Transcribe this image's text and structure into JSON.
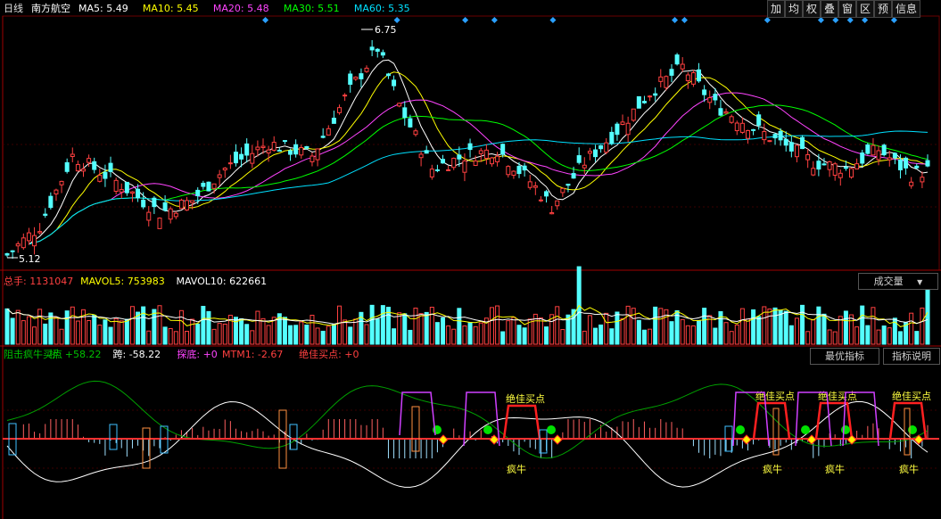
{
  "header": {
    "period": "日线",
    "stock": "南方航空",
    "ma_items": [
      {
        "label": "MA5: 5.49",
        "color": "#ffffff"
      },
      {
        "label": "MA10: 5.45",
        "color": "#ffff00"
      },
      {
        "label": "MA20: 5.48",
        "color": "#ff44ff"
      },
      {
        "label": "MA30: 5.51",
        "color": "#00ff00"
      },
      {
        "label": "MA60: 5.35",
        "color": "#00e0ff"
      }
    ]
  },
  "toolbar": [
    "加",
    "均",
    "权",
    "叠",
    "窗",
    "区",
    "预",
    "信息"
  ],
  "price_chart": {
    "type": "candlestick",
    "high_label": "6.75",
    "low_label": "5.12",
    "ymin": 5.0,
    "ymax": 7.0,
    "num_bars": 170,
    "markers": [
      53,
      80,
      94,
      100,
      112,
      137,
      139,
      156,
      167,
      170,
      173,
      176,
      182
    ],
    "ma_colors": {
      "ma5": "#ffffff",
      "ma10": "#ffff00",
      "ma20": "#ff44ff",
      "ma30": "#00ff00",
      "ma60": "#00e0ff"
    }
  },
  "volume_panel": {
    "items": [
      {
        "label": "总手: 1131047",
        "color": "#ff4040"
      },
      {
        "label": "MAVOL5: 753983",
        "color": "#ffff00"
      },
      {
        "label": "MAVOL10: 622661",
        "color": "#ffffff"
      }
    ],
    "dropdown": "成交量"
  },
  "indicator_panel": {
    "items": [
      {
        "label": "阻击疯牛买点",
        "color": "#00c000"
      },
      {
        "label": "桥: +58.22",
        "color": "#00c000"
      },
      {
        "label": "跨: -58.22",
        "color": "#ffffff"
      },
      {
        "label": "探底: +0",
        "color": "#ff44ff"
      },
      {
        "label": "MTM1: -2.67",
        "color": "#ff4040"
      },
      {
        "label": "绝佳买点: +0",
        "color": "#ff4040"
      }
    ],
    "button_best": "最优指标",
    "button_help": "指标说明",
    "buy_label": "绝佳买点",
    "bull_label": "疯牛"
  },
  "chart_data": {
    "type": "candlestick",
    "title": "南方航空",
    "period": "日线",
    "ylim": [
      5.0,
      7.0
    ],
    "high": 6.75,
    "low": 5.12,
    "last_ma": {
      "MA5": 5.49,
      "MA10": 5.45,
      "MA20": 5.48,
      "MA30": 5.51,
      "MA60": 5.35
    },
    "volume": {
      "total": 1131047,
      "MAVOL5": 753983,
      "MAVOL10": 622661
    },
    "indicator": {
      "桥": 58.22,
      "跨": -58.22,
      "探底": 0,
      "MTM1": -2.67,
      "绝佳买点": 0
    }
  }
}
